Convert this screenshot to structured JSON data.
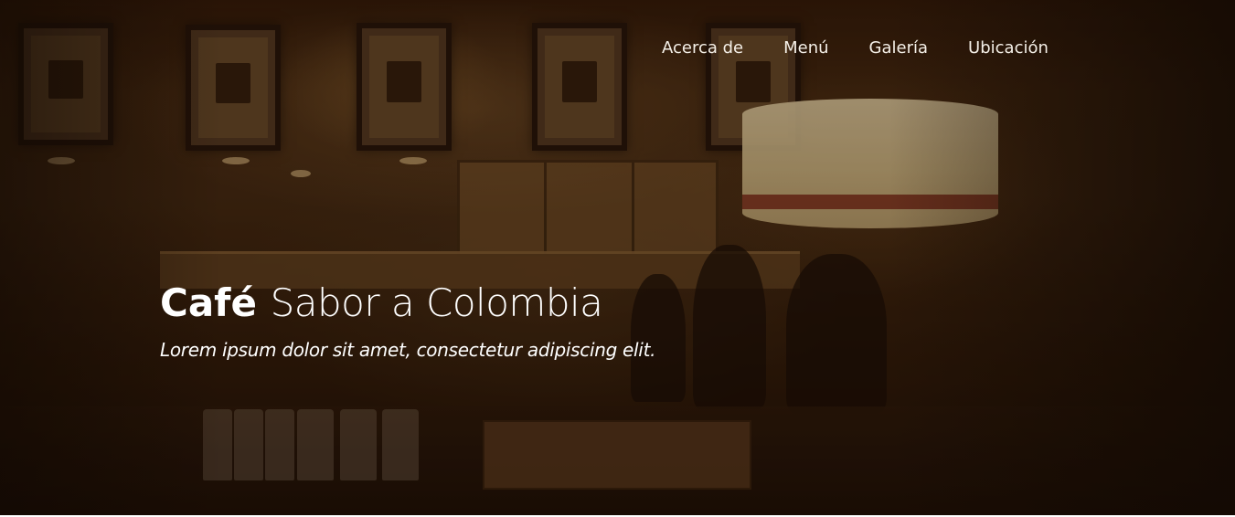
{
  "nav": {
    "items": [
      {
        "label": "Acerca de"
      },
      {
        "label": "Menú"
      },
      {
        "label": "Galería"
      },
      {
        "label": "Ubicación"
      }
    ]
  },
  "hero": {
    "title_strong": "Café",
    "title_light": "Sabor a Colombia",
    "subtitle": "Lorem ipsum dolor sit amet, consectetur adipiscing elit."
  },
  "colors": {
    "overlay": "#2a1608",
    "text": "#ffffff",
    "nav_text": "#f4efe7"
  }
}
